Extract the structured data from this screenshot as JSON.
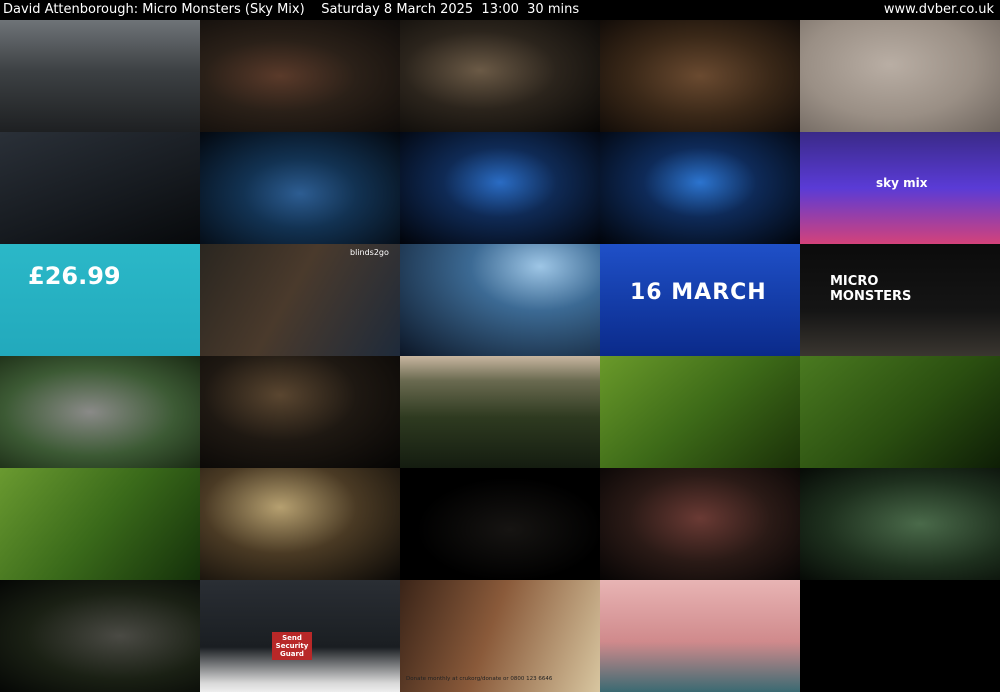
{
  "header": {
    "title": "David Attenborough: Micro Monsters (Sky Mix)    Saturday 8 March 2025  13:00  30 mins",
    "site": "www.dvber.co.uk"
  },
  "frames": [
    {
      "bg": "linear-gradient(180deg,#6f7478 0%,#3d4144 45%,#1e2022 100%)"
    },
    {
      "bg": "radial-gradient(ellipse at 40% 50%,#5a3a2a 0%,#2a2018 45%,#0f0c0a 100%)"
    },
    {
      "bg": "radial-gradient(ellipse at 40% 45%,#6b5a46 0%,#2b241c 45%,#070605 100%)"
    },
    {
      "bg": "radial-gradient(ellipse at 50% 50%,#6a4a30 0%,#3a2818 50%,#120c08 100%)"
    },
    {
      "bg": "radial-gradient(ellipse at 45% 40%,#b9aea4 0%,#9a8f85 55%,#6e655e 100%)"
    },
    {
      "bg": "linear-gradient(160deg,#2a3038 0%,#15191e 60%,#07090b 100%)"
    },
    {
      "bg": "radial-gradient(ellipse at 50% 55%,#2d5d92 0%,#123252 40%,#03080f 100%)"
    },
    {
      "bg": "radial-gradient(ellipse at 50% 45%,#2a6cc4 0%,#0f2a55 40%,#010309 100%)"
    },
    {
      "bg": "radial-gradient(ellipse at 50% 45%,#2c74cf 0%,#0e2a58 40%,#01040a 100%)"
    },
    {
      "bg": "linear-gradient(180deg,#3a2a88 0%,#5a3bd6 50%,#d4427a 100%)",
      "text": "sky mix"
    },
    {
      "bg": "linear-gradient(180deg,#2bb8c8 0%,#22a9bc 100%)",
      "text": "£26.99"
    },
    {
      "bg": "linear-gradient(120deg,#2a2620 0%,#4a3a2c 45%,#1e2a3a 100%)",
      "text": "blinds2go"
    },
    {
      "bg": "radial-gradient(ellipse at 70% 20%,#9ec6e6 0%,#3c6a94 35%,#0c1626 100%)"
    },
    {
      "bg": "linear-gradient(180deg,#1f50c8 0%,#0a2a8a 100%)",
      "text": "16 MARCH"
    },
    {
      "bg": "linear-gradient(180deg,#0b0b0b 0%,#151515 60%,#3a3630 100%)",
      "text": "MICRO MONSTERS"
    },
    {
      "bg": "radial-gradient(ellipse at 45% 50%,#8a8a88 0%,#3c5a34 55%,#1a2a14 100%)"
    },
    {
      "bg": "radial-gradient(ellipse at 40% 35%,#5a4630 0%,#1e1812 45%,#050403 100%)"
    },
    {
      "bg": "linear-gradient(180deg,#c8b6a0 0%,#6a6a50 22%,#2e3a20 55%,#141c10 100%)"
    },
    {
      "bg": "linear-gradient(140deg,#6a9a2a 0%,#3d6a18 50%,#1a3008 100%)"
    },
    {
      "bg": "linear-gradient(140deg,#4a7a20 0%,#2a4e10 55%,#0e1e06 100%)"
    },
    {
      "bg": "linear-gradient(130deg,#6a9a30 0%,#3a6a1a 50%,#14300a 100%)"
    },
    {
      "bg": "radial-gradient(ellipse at 40% 35%,#b6a070 0%,#4a3a24 45%,#0a0806 100%)"
    },
    {
      "bg": "radial-gradient(ellipse at 55% 55%,#161412 0%,#000 60%)"
    },
    {
      "bg": "radial-gradient(ellipse at 50% 45%,#6a3a34 0%,#2a1a16 50%,#060404 100%)"
    },
    {
      "bg": "radial-gradient(ellipse at 60% 50%,#4a6a4a 0%,#1e301e 55%,#060a06 100%)"
    },
    {
      "bg": "radial-gradient(ellipse at 60% 50%,#4a4a44 0%,#1a2014 55%,#050705 100%)"
    },
    {
      "bg": "linear-gradient(180deg,#2a2e34 0%,#1a1e22 60%,#d8d8d8 92%,#eee 100%)",
      "text": "Send Security Guard"
    },
    {
      "bg": "linear-gradient(110deg,#3a2418 0%,#8a5a3a 45%,#d8c6a0 100%)",
      "text": "Donate monthly at crukorg/donate or 0800 123 6646"
    },
    {
      "bg": "linear-gradient(180deg,#e8b4b4 0%,#d08a8c 55%,#3a6a72 100%)"
    },
    {
      "bg": "#000"
    }
  ]
}
